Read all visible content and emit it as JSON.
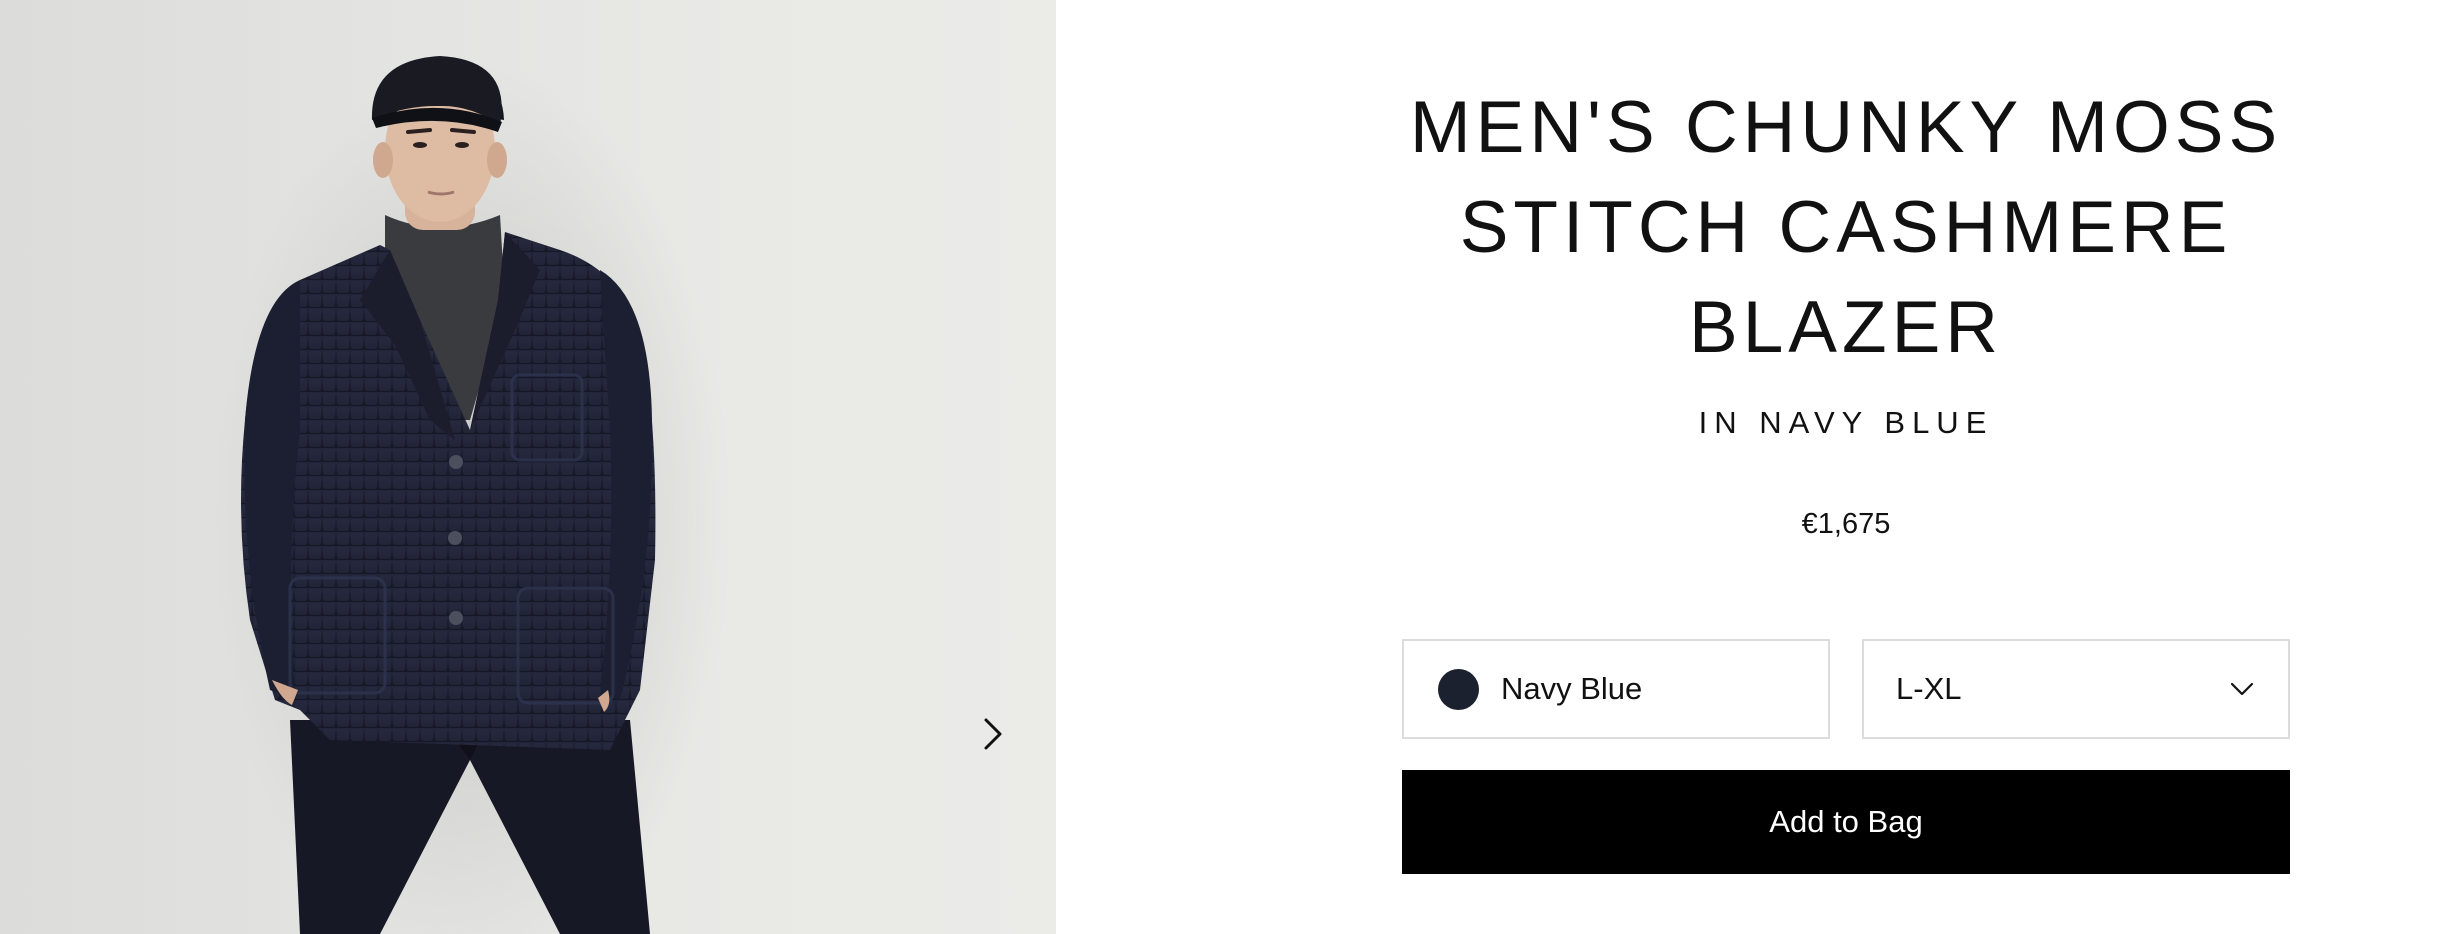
{
  "gallery": {
    "image": "product-photo-model-wearing-navy-knit-blazer",
    "next_icon": "chevron-right-icon"
  },
  "product": {
    "title": "MEN'S CHUNKY MOSS STITCH CASHMERE BLAZER",
    "subtitle": "IN NAVY BLUE",
    "price": "€1,675"
  },
  "options": {
    "color": {
      "label": "Navy Blue",
      "swatch_color": "#1c2130"
    },
    "size": {
      "selected": "L-XL",
      "icon": "chevron-down-icon"
    }
  },
  "actions": {
    "add_to_bag": "Add to Bag"
  },
  "colors": {
    "button_bg": "#000000",
    "button_text": "#ffffff",
    "border": "#dcdcdc"
  }
}
